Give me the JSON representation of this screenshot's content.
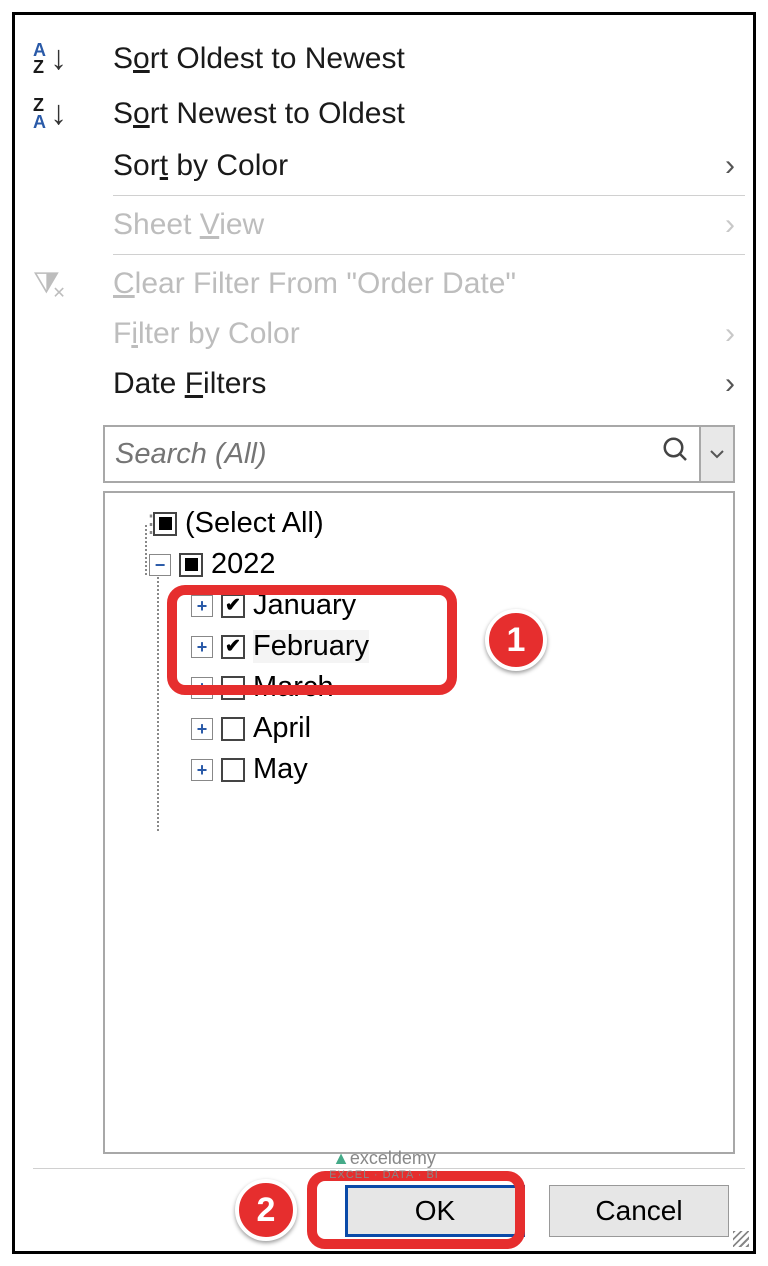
{
  "menu": {
    "sort_asc_pre": "S",
    "sort_asc_u": "o",
    "sort_asc_post": "rt Oldest to Newest",
    "sort_desc_pre": "S",
    "sort_desc_u": "o",
    "sort_desc_post": "rt Newest to Oldest",
    "sort_color_pre": "Sor",
    "sort_color_u": "t",
    "sort_color_post": " by Color",
    "sheet_view_pre": "Sheet ",
    "sheet_view_u": "V",
    "sheet_view_post": "iew",
    "clear_filter_u": "C",
    "clear_filter_post": "lear Filter From \"Order Date\"",
    "filter_color_pre": "F",
    "filter_color_u": "i",
    "filter_color_post": "lter by Color",
    "date_filters_pre": "Date ",
    "date_filters_u": "F",
    "date_filters_post": "ilters"
  },
  "search": {
    "placeholder": "Search (All)"
  },
  "tree": {
    "select_all": "(Select All)",
    "year": "2022",
    "months": [
      "January",
      "February",
      "March",
      "April",
      "May"
    ]
  },
  "buttons": {
    "ok": "OK",
    "cancel": "Cancel"
  },
  "badges": {
    "one": "1",
    "two": "2"
  },
  "watermark": {
    "name": "exceldemy",
    "sub": "EXCEL · DATA · BI"
  }
}
